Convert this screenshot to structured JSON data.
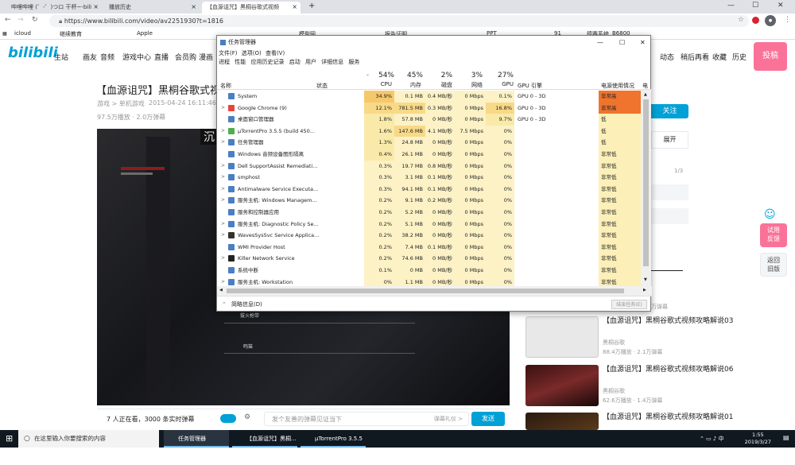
{
  "browser": {
    "tabs": [
      {
        "label": "哔哩哔哩 (゜-゜)つロ 干杯~-bili",
        "active": false
      },
      {
        "label": "播放历史",
        "active": false
      },
      {
        "label": "【血源诅咒】黑桐谷歌式视频",
        "active": true
      }
    ],
    "new_tab": "+",
    "url": "https://www.bilibili.com/video/av2251930?t=1816",
    "bookmarks": [
      "icloud",
      "继续教育",
      "Apple",
      "模型网",
      "报告证明",
      "PPT",
      "91",
      "德赛系统",
      "B6800"
    ]
  },
  "bili": {
    "logo": "bilibili",
    "nav": [
      "主站",
      "画友",
      "游戏中心",
      "直播",
      "会员购",
      "漫画"
    ],
    "right_nav": [
      "动态",
      "稍后再看",
      "收藏",
      "历史"
    ],
    "post": "投稿",
    "video_title": "【血源诅咒】黑桐谷歌式视频攻",
    "category": "游戏 > 单机游戏",
    "date": "2015-04-24 16:11:46",
    "stats": "97.5万播放 · 2.0万弹幕",
    "player_overlay": "沉",
    "player_labels": [
      "拔火枪带",
      "鸣笛"
    ],
    "watching": "7 人正在看，3000 条实时弹幕",
    "danmaku_placeholder": "发个友善的弹幕见证当下",
    "danmaku_etiquette": "弹幕礼仪 >",
    "send": "发送",
    "follow": "关注",
    "expand": "展开",
    "page": "1/3",
    "feedback": [
      "试用",
      "反馈"
    ],
    "back_old": [
      "返回",
      "旧版"
    ],
    "count_cut": "万弹幕"
  },
  "recommendations": [
    {
      "title": "【血源诅咒】黑桐谷歌式视频攻略解说03",
      "up": "黑桐谷歌",
      "stats": "88.4万播放 · 2.1万弹幕",
      "color": "#ddd"
    },
    {
      "title": "【血源诅咒】黑桐谷歌式视频攻略解说06",
      "up": "黑桐谷歌",
      "stats": "62.6万播放 · 1.4万弹幕",
      "color": "#5a1a1a"
    },
    {
      "title": "【血源诅咒】黑桐谷歌式视频攻略解说01",
      "up": "",
      "stats": "",
      "color": "#3a2a1a"
    }
  ],
  "task_manager": {
    "title": "任务管理器",
    "menu": [
      "文件(F)",
      "选项(O)",
      "查看(V)"
    ],
    "tabs": [
      "进程",
      "性能",
      "应用历史记录",
      "启动",
      "用户",
      "详细信息",
      "服务"
    ],
    "columns": {
      "name": "名称",
      "status": "状态",
      "gpu_engine": "GPU 引擎",
      "power": "电源使用情况",
      "power_trend": "电源"
    },
    "totals": {
      "cpu": "54%",
      "mem": "45%",
      "disk": "2%",
      "net": "3%",
      "gpu": "27%"
    },
    "units": {
      "cpu": "CPU",
      "mem": "内存",
      "disk": "磁盘",
      "net": "网络",
      "gpu": "GPU"
    },
    "rows": [
      {
        "name": "System",
        "arrow": "",
        "cpu": "34.9%",
        "mem": "0.1 MB",
        "disk": "0.4 MB/秒",
        "net": "0 Mbps",
        "gpu": "0.1%",
        "engine": "GPU 0 - 3D",
        "power": "非常高",
        "icon": "#4a7fc1"
      },
      {
        "name": "Google Chrome (9)",
        "arrow": ">",
        "cpu": "12.1%",
        "mem": "781.5 MB",
        "disk": "0.3 MB/秒",
        "net": "0 Mbps",
        "gpu": "16.8%",
        "engine": "GPU 0 - 3D",
        "power": "非常高",
        "icon": "#e8453c"
      },
      {
        "name": "桌面窗口管理器",
        "arrow": "",
        "cpu": "1.8%",
        "mem": "57.8 MB",
        "disk": "0 MB/秒",
        "net": "0 Mbps",
        "gpu": "9.7%",
        "engine": "GPU 0 - 3D",
        "power": "低",
        "icon": "#4a7fc1"
      },
      {
        "name": "μTorrentPro 3.5.5 (build 450...",
        "arrow": ">",
        "cpu": "1.6%",
        "mem": "147.6 MB",
        "disk": "4.1 MB/秒",
        "net": "7.5 Mbps",
        "gpu": "0%",
        "engine": "",
        "power": "低",
        "icon": "#4caf50"
      },
      {
        "name": "任务管理器",
        "arrow": ">",
        "cpu": "1.3%",
        "mem": "24.8 MB",
        "disk": "0 MB/秒",
        "net": "0 Mbps",
        "gpu": "0%",
        "engine": "",
        "power": "低",
        "icon": "#4a7fc1"
      },
      {
        "name": "Windows 音频设备图形隔离",
        "arrow": "",
        "cpu": "0.4%",
        "mem": "26.1 MB",
        "disk": "0 MB/秒",
        "net": "0 Mbps",
        "gpu": "0%",
        "engine": "",
        "power": "非常低",
        "icon": "#4a7fc1"
      },
      {
        "name": "Dell SupportAssist Remediati...",
        "arrow": ">",
        "cpu": "0.3%",
        "mem": "19.7 MB",
        "disk": "0.8 MB/秒",
        "net": "0 Mbps",
        "gpu": "0%",
        "engine": "",
        "power": "非常低",
        "icon": "#4a7fc1"
      },
      {
        "name": "smphost",
        "arrow": ">",
        "cpu": "0.3%",
        "mem": "3.1 MB",
        "disk": "0.1 MB/秒",
        "net": "0 Mbps",
        "gpu": "0%",
        "engine": "",
        "power": "非常低",
        "icon": "#4a7fc1"
      },
      {
        "name": "Antimalware Service Executa...",
        "arrow": ">",
        "cpu": "0.3%",
        "mem": "94.1 MB",
        "disk": "0.1 MB/秒",
        "net": "0 Mbps",
        "gpu": "0%",
        "engine": "",
        "power": "非常低",
        "icon": "#4a7fc1"
      },
      {
        "name": "服务主机: Windows Managem...",
        "arrow": ">",
        "cpu": "0.2%",
        "mem": "9.1 MB",
        "disk": "0.2 MB/秒",
        "net": "0 Mbps",
        "gpu": "0%",
        "engine": "",
        "power": "非常低",
        "icon": "#4a7fc1"
      },
      {
        "name": "服务和控制器应用",
        "arrow": "",
        "cpu": "0.2%",
        "mem": "5.2 MB",
        "disk": "0 MB/秒",
        "net": "0 Mbps",
        "gpu": "0%",
        "engine": "",
        "power": "非常低",
        "icon": "#4a7fc1"
      },
      {
        "name": "服务主机: Diagnostic Policy Se...",
        "arrow": ">",
        "cpu": "0.2%",
        "mem": "5.1 MB",
        "disk": "0 MB/秒",
        "net": "0 Mbps",
        "gpu": "0%",
        "engine": "",
        "power": "非常低",
        "icon": "#4a7fc1"
      },
      {
        "name": "WavesSysSvc Service Applica...",
        "arrow": ">",
        "cpu": "0.2%",
        "mem": "38.2 MB",
        "disk": "0 MB/秒",
        "net": "0 Mbps",
        "gpu": "0%",
        "engine": "",
        "power": "非常低",
        "icon": "#333"
      },
      {
        "name": "WMI Provider Host",
        "arrow": "",
        "cpu": "0.2%",
        "mem": "7.4 MB",
        "disk": "0.1 MB/秒",
        "net": "0 Mbps",
        "gpu": "0%",
        "engine": "",
        "power": "非常低",
        "icon": "#4a7fc1"
      },
      {
        "name": "Killer Network Service",
        "arrow": ">",
        "cpu": "0.2%",
        "mem": "74.6 MB",
        "disk": "0 MB/秒",
        "net": "0 Mbps",
        "gpu": "0%",
        "engine": "",
        "power": "非常低",
        "icon": "#222"
      },
      {
        "name": "系统中断",
        "arrow": "",
        "cpu": "0.1%",
        "mem": "0 MB",
        "disk": "0 MB/秒",
        "net": "0 Mbps",
        "gpu": "0%",
        "engine": "",
        "power": "非常低",
        "icon": "#4a7fc1"
      },
      {
        "name": "服务主机: Workstation",
        "arrow": ">",
        "cpu": "0%",
        "mem": "1.1 MB",
        "disk": "0 MB/秒",
        "net": "0 Mbps",
        "gpu": "0%",
        "engine": "",
        "power": "非常低",
        "icon": "#4a7fc1"
      }
    ],
    "less_details": "简略信息(D)",
    "end_task": "结束任务(E)"
  },
  "taskbar": {
    "search": "在这里输入你要搜索的内容",
    "apps": [
      "任务管理器",
      "【血源诅咒】黑桐...",
      "μTorrentPro 3.5.5 ..."
    ],
    "time": "1:55",
    "date": "2019/3/27"
  }
}
